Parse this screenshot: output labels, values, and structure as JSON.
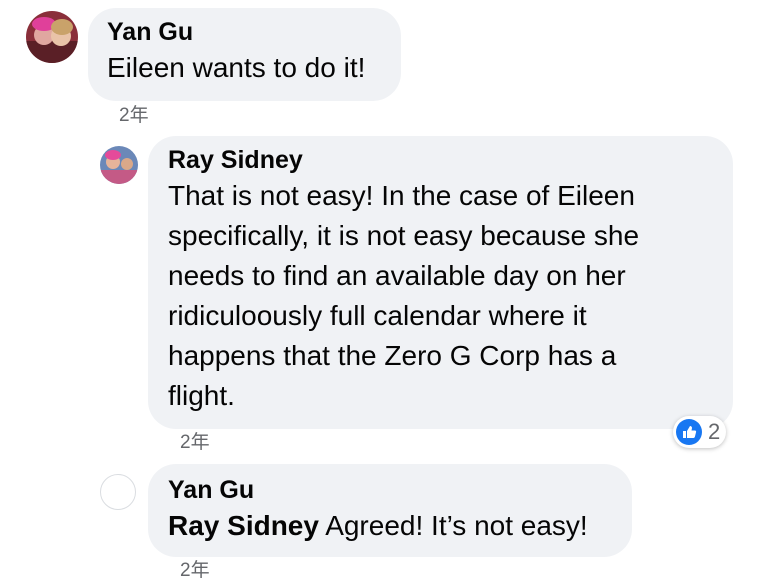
{
  "comments": [
    {
      "author": "Yan Gu",
      "text": "Eileen wants to do it!",
      "time": "2年"
    },
    {
      "author": "Ray Sidney",
      "text_lines": [
        "That is not easy! In the case of Eileen",
        "specifically, it is not easy because she",
        "needs to find an available day on her",
        "ridiculoously full calendar where it",
        "happens that the Zero G Corp has a",
        "flight."
      ],
      "time": "2年",
      "reaction": {
        "icon": "like-icon",
        "count": "2"
      }
    },
    {
      "author": "Yan Gu",
      "mention": "Ray Sidney",
      "text": "Agreed! It’s not easy!",
      "time": "2年"
    }
  ],
  "colors": {
    "bubble": "#f0f2f5",
    "like": "#1877f2",
    "meta": "#65676b"
  }
}
